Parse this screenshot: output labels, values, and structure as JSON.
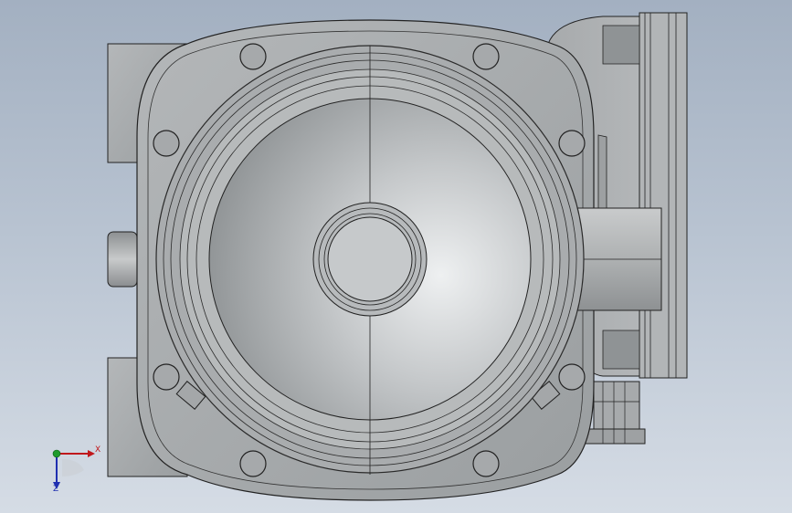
{
  "viewport": {
    "background_top": "#a3b0c1",
    "background_bottom": "#d5dce5"
  },
  "triad": {
    "x_label": "X",
    "z_label": "Z",
    "x_color": "#c0181c",
    "y_color": "#1f9a2c",
    "z_color": "#1f2fb0"
  }
}
